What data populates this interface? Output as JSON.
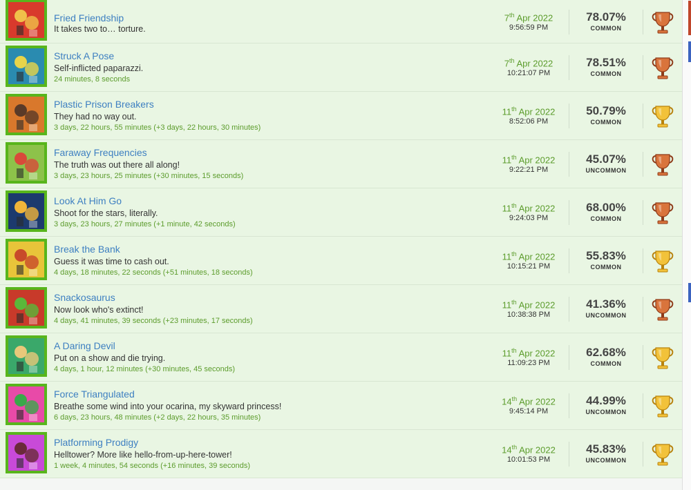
{
  "achievements": [
    {
      "title": "Fried Friendship",
      "desc": "It takes two to… torture.",
      "time": "",
      "day": "7",
      "suffix": "th",
      "monthyear": "Apr 2022",
      "clock": "9:56:59 PM",
      "percent": "78.07%",
      "rarity": "COMMON",
      "trophy": "bronze-trophy-icon",
      "icon": "fried-friendship-icon",
      "palette": [
        "#d83a2c",
        "#f0c04a"
      ]
    },
    {
      "title": "Struck A Pose",
      "desc": "Self-inflicted paparazzi.",
      "time": "24 minutes, 8 seconds",
      "day": "7",
      "suffix": "th",
      "monthyear": "Apr 2022",
      "clock": "10:21:07 PM",
      "percent": "78.51%",
      "rarity": "COMMON",
      "trophy": "bronze-trophy-icon",
      "icon": "struck-a-pose-icon",
      "palette": [
        "#2a8bb0",
        "#e8d44a"
      ]
    },
    {
      "title": "Plastic Prison Breakers",
      "desc": "They had no way out.",
      "time": "3 days, 22 hours, 55 minutes (+3 days, 22 hours, 30 minutes)",
      "day": "11",
      "suffix": "th",
      "monthyear": "Apr 2022",
      "clock": "8:52:06 PM",
      "percent": "50.79%",
      "rarity": "COMMON",
      "trophy": "gold-trophy-icon",
      "icon": "plastic-prison-breakers-icon",
      "palette": [
        "#d9782c",
        "#5a3a28"
      ]
    },
    {
      "title": "Faraway Frequencies",
      "desc": "The truth was out there all along!",
      "time": "3 days, 23 hours, 25 minutes (+30 minutes, 15 seconds)",
      "day": "11",
      "suffix": "th",
      "monthyear": "Apr 2022",
      "clock": "9:22:21 PM",
      "percent": "45.07%",
      "rarity": "UNCOMMON",
      "trophy": "bronze-trophy-icon",
      "icon": "faraway-frequencies-icon",
      "palette": [
        "#8dc24a",
        "#d84a3a"
      ]
    },
    {
      "title": "Look At Him Go",
      "desc": "Shoot for the stars, literally.",
      "time": "3 days, 23 hours, 27 minutes (+1 minute, 42 seconds)",
      "day": "11",
      "suffix": "th",
      "monthyear": "Apr 2022",
      "clock": "9:24:03 PM",
      "percent": "68.00%",
      "rarity": "COMMON",
      "trophy": "bronze-trophy-icon",
      "icon": "look-at-him-go-icon",
      "palette": [
        "#1c3a6e",
        "#f0b43a"
      ]
    },
    {
      "title": "Break the Bank",
      "desc": "Guess it was time to cash out.",
      "time": "4 days, 18 minutes, 22 seconds (+51 minutes, 18 seconds)",
      "day": "11",
      "suffix": "th",
      "monthyear": "Apr 2022",
      "clock": "10:15:21 PM",
      "percent": "55.83%",
      "rarity": "COMMON",
      "trophy": "gold-trophy-icon",
      "icon": "break-the-bank-icon",
      "palette": [
        "#e8c43a",
        "#c84a2a"
      ]
    },
    {
      "title": "Snackosaurus",
      "desc": "Now look who's extinct!",
      "time": "4 days, 41 minutes, 39 seconds (+23 minutes, 17 seconds)",
      "day": "11",
      "suffix": "th",
      "monthyear": "Apr 2022",
      "clock": "10:38:38 PM",
      "percent": "41.36%",
      "rarity": "UNCOMMON",
      "trophy": "bronze-trophy-icon",
      "icon": "snackosaurus-icon",
      "palette": [
        "#c83a2a",
        "#5ab83a"
      ]
    },
    {
      "title": "A Daring Devil",
      "desc": "Put on a show and die trying.",
      "time": "4 days, 1 hour, 12 minutes (+30 minutes, 45 seconds)",
      "day": "11",
      "suffix": "th",
      "monthyear": "Apr 2022",
      "clock": "11:09:23 PM",
      "percent": "62.68%",
      "rarity": "COMMON",
      "trophy": "gold-trophy-icon",
      "icon": "a-daring-devil-icon",
      "palette": [
        "#3aa86a",
        "#e8c87a"
      ]
    },
    {
      "title": "Force Triangulated",
      "desc": "Breathe some wind into your ocarina, my skyward princess!",
      "time": "6 days, 23 hours, 48 minutes (+2 days, 22 hours, 35 minutes)",
      "day": "14",
      "suffix": "th",
      "monthyear": "Apr 2022",
      "clock": "9:45:14 PM",
      "percent": "44.99%",
      "rarity": "UNCOMMON",
      "trophy": "gold-trophy-icon",
      "icon": "force-triangulated-icon",
      "palette": [
        "#e84aa8",
        "#3aa84a"
      ]
    },
    {
      "title": "Platforming Prodigy",
      "desc": "Helltower? More like hello-from-up-here-tower!",
      "time": "1 week, 4 minutes, 54 seconds (+16 minutes, 39 seconds)",
      "day": "14",
      "suffix": "th",
      "monthyear": "Apr 2022",
      "clock": "10:01:53 PM",
      "percent": "45.83%",
      "rarity": "UNCOMMON",
      "trophy": "gold-trophy-icon",
      "icon": "platforming-prodigy-icon",
      "palette": [
        "#c84ad8",
        "#6a2a3a"
      ]
    }
  ],
  "colors": {
    "bronze": "#c8602c",
    "gold": "#e0a820",
    "frame": "#58b51c"
  }
}
